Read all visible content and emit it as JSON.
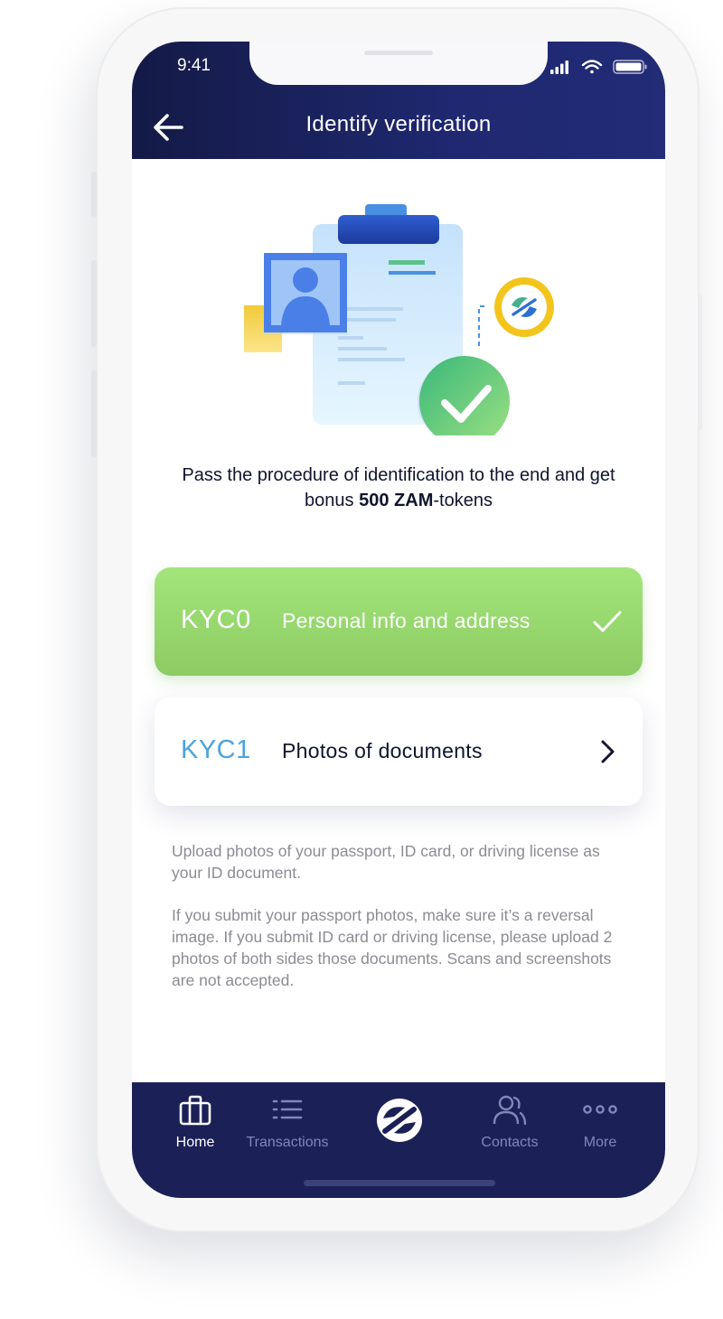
{
  "status_bar": {
    "time": "9:41",
    "icons": [
      "signal-icon",
      "wifi-icon",
      "battery-icon"
    ]
  },
  "header": {
    "title": "Identify verification",
    "back_icon": "arrow-left-icon"
  },
  "hero": {
    "illustration": "id-clipboard-verified-illustration"
  },
  "lead": {
    "text_before": "Pass the procedure of identification to the end and get bonus ",
    "bold": "500 ZAM",
    "text_after": "-tokens"
  },
  "steps": [
    {
      "code": "KYC0",
      "label": "Personal info and address",
      "status": "completed",
      "icon": "check-icon"
    },
    {
      "code": "KYC1",
      "label": "Photos of documents",
      "status": "pending",
      "icon": "chevron-right-icon"
    }
  ],
  "info": {
    "paragraph1": "Upload photos of your passport, ID card, or driving license as your ID document.",
    "paragraph2": "If you submit your passport photos, make sure it’s a reversal image. If you submit ID card or driving license, please upload 2 photos of both sides those documents. Scans and screenshots are not accepted."
  },
  "tabbar": {
    "items": [
      {
        "label": "Home",
        "icon": "briefcase-icon",
        "active": true
      },
      {
        "label": "Transactions",
        "icon": "list-icon",
        "active": false
      },
      {
        "label": "",
        "icon": "zam-logo-icon",
        "active": false
      },
      {
        "label": "Contacts",
        "icon": "users-icon",
        "active": false
      },
      {
        "label": "More",
        "icon": "more-dots-icon",
        "active": false
      }
    ]
  },
  "colors": {
    "header_dark": "#141a46",
    "header_light": "#222c77",
    "success_green": "#98d96f",
    "kyc_blue": "#4aa3e0",
    "tabbar_bg": "#1b2157",
    "muted_text": "#8b8b93"
  }
}
